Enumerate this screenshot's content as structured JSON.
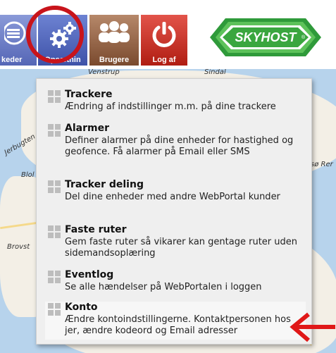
{
  "toolbar": {
    "buttons": [
      {
        "id": "flaader",
        "label": "keder",
        "icon": "menu-circle-icon"
      },
      {
        "id": "opsaetning",
        "label": "Opsætnin",
        "icon": "gears-icon"
      },
      {
        "id": "brugere",
        "label": "Brugere",
        "icon": "users-icon"
      },
      {
        "id": "logaf",
        "label": "Log af",
        "icon": "power-icon"
      }
    ],
    "logo_text": "SKYHOST",
    "logo_mark": "®"
  },
  "map": {
    "labels": [
      "Blol",
      "Brovst",
      "Sindal",
      "Venstrup",
      "Jerbugten",
      "sø Rer"
    ]
  },
  "menu": {
    "items": [
      {
        "title": "Trackere",
        "desc": "Ændring af indstillinger m.m. på dine trackere"
      },
      {
        "title": "Alarmer",
        "desc": "Definer alarmer på dine enheder for hastighed og geofence. Få alarmer på Email eller SMS"
      },
      {
        "title": "Tracker deling",
        "desc": "Del dine enheder med andre WebPortal kunder"
      },
      {
        "title": "Faste ruter",
        "desc": "Gem faste ruter så vikarer kan gentage ruter uden sidemandsoplæring"
      },
      {
        "title": "Eventlog",
        "desc": "Se alle hændelser på WebPortalen i loggen"
      },
      {
        "title": "Konto",
        "desc": "Ændre kontoindstillingerne. Kontaktpersonen hos jer, ændre kodeord og Email adresser"
      }
    ]
  },
  "colors": {
    "highlight": "#c8141b",
    "logo_green": "#2f9a3a"
  }
}
